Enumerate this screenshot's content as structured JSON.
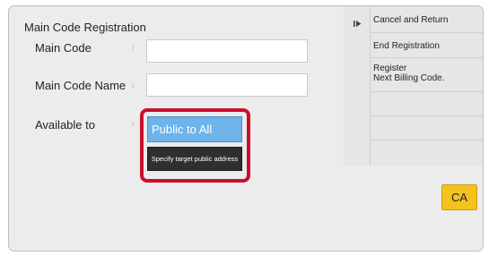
{
  "form": {
    "title": "Main Code Registration",
    "main_code_label": "Main Code",
    "main_code_value": "",
    "main_code_name_label": "Main Code Name",
    "main_code_name_value": "",
    "available_to_label": "Available to",
    "public_to_all_label": "Public to All",
    "specify_target_label": "Specify target public address"
  },
  "side_menu": {
    "items": [
      {
        "lines": [
          "Cancel and Return"
        ]
      },
      {
        "lines": [
          "End Registration"
        ]
      },
      {
        "lines": [
          "Register",
          "Next Billing Code."
        ]
      },
      {
        "lines": []
      },
      {
        "lines": []
      },
      {
        "lines": []
      }
    ]
  },
  "ca_button": {
    "label": "CA"
  },
  "colors": {
    "public_button": "#6eb4e9",
    "highlight_border": "#c8102e",
    "ca_button": "#f3c21d",
    "panel_background": "#ececec"
  },
  "icons": {
    "side_arrow": "play-right-icon"
  }
}
